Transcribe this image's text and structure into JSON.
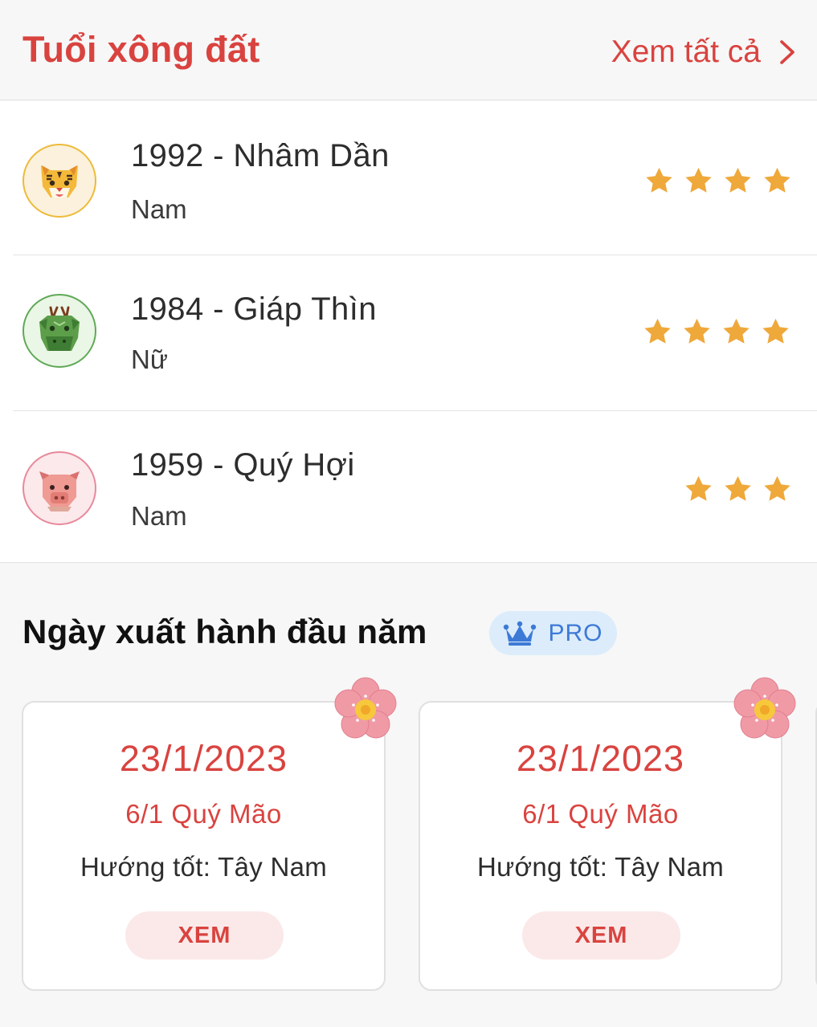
{
  "header": {
    "title": "Tuổi xông đất",
    "see_all": "Xem tất cả"
  },
  "ages": [
    {
      "name": "1992 - Nhâm Dần",
      "gender": "Nam",
      "zodiac_icon": "tiger-icon",
      "rating": 4
    },
    {
      "name": "1984 - Giáp Thìn",
      "gender": "Nữ",
      "zodiac_icon": "dragon-icon",
      "rating": 4
    },
    {
      "name": "1959 - Quý Hợi",
      "gender": "Nam",
      "zodiac_icon": "pig-icon",
      "rating": 3
    }
  ],
  "departure": {
    "title": "Ngày xuất hành đầu năm",
    "badge": "PRO",
    "cards": [
      {
        "date": "23/1/2023",
        "lunar": "6/1 Quý Mão",
        "direction": "Hướng tốt: Tây Nam",
        "button": "XEM"
      },
      {
        "date": "23/1/2023",
        "lunar": "6/1 Quý Mão",
        "direction": "Hướng tốt: Tây Nam",
        "button": "XEM"
      }
    ]
  },
  "colors": {
    "accent": "#d9433f",
    "star": "#efa83a",
    "pro_bg": "#dcecfb",
    "pro_text": "#3d7ad6",
    "button_bg": "#fbe9e9"
  }
}
